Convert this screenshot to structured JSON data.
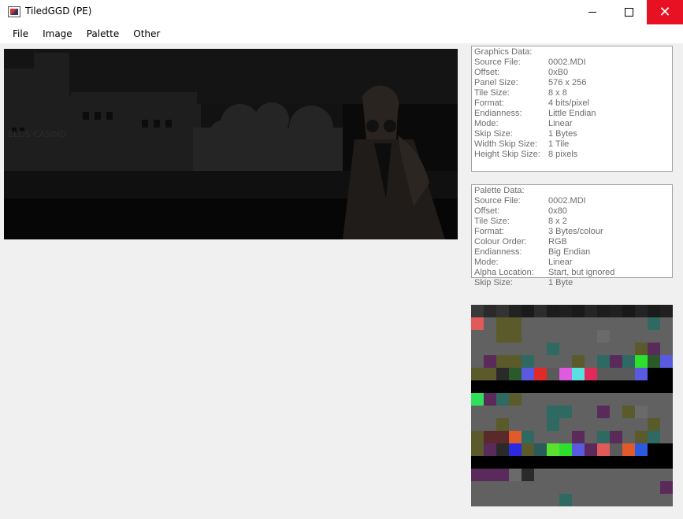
{
  "window": {
    "title": "TiledGGD (PE)"
  },
  "menu": [
    "File",
    "Image",
    "Palette",
    "Other"
  ],
  "graphics": {
    "heading": "Graphics Data:",
    "rows": [
      {
        "k": "Source File:",
        "v": "0002.MDI"
      },
      {
        "k": "Offset:",
        "v": "0xB0"
      },
      {
        "k": "Panel Size:",
        "v": "576 x 256"
      },
      {
        "k": "Tile Size:",
        "v": "8 x 8"
      },
      {
        "k": "Format:",
        "v": "4 bits/pixel"
      },
      {
        "k": "Endianness:",
        "v": "Little Endian"
      },
      {
        "k": "Mode:",
        "v": "Linear"
      },
      {
        "k": "Skip Size:",
        "v": "1 Bytes"
      },
      {
        "k": "Width Skip Size:",
        "v": "1 Tile"
      },
      {
        "k": "Height Skip Size:",
        "v": "8 pixels"
      }
    ]
  },
  "palette": {
    "heading": "Palette Data:",
    "rows": [
      {
        "k": "Source File:",
        "v": "0002.MDI"
      },
      {
        "k": "Offset:",
        "v": "0x80"
      },
      {
        "k": "Tile Size:",
        "v": "8 x 2"
      },
      {
        "k": "Format:",
        "v": "3 Bytes/colour"
      },
      {
        "k": "Colour Order:",
        "v": "RGB"
      },
      {
        "k": "Endianness:",
        "v": "Big Endian"
      },
      {
        "k": "Mode:",
        "v": "Linear"
      },
      {
        "k": "Alpha Location:",
        "v": "Start, but ignored"
      },
      {
        "k": "Skip Size:",
        "v": "1 Byte"
      }
    ]
  },
  "colors": {
    "close_button": "#e81123",
    "panel_border": "#a0a0a0",
    "label_text": "#6d6d6d",
    "palette_bg": "#616161"
  },
  "palette_swatches": [
    {
      "row": 0,
      "col": 0,
      "color": "#3a3a3a"
    },
    {
      "row": 0,
      "col": 1,
      "color": "#2a2a2a"
    },
    {
      "row": 0,
      "col": 2,
      "color": "#333333"
    },
    {
      "row": 0,
      "col": 3,
      "color": "#222222"
    },
    {
      "row": 0,
      "col": 4,
      "color": "#1a1a1a"
    },
    {
      "row": 0,
      "col": 5,
      "color": "#2c2c2c"
    },
    {
      "row": 0,
      "col": 6,
      "color": "#1c1c1c"
    },
    {
      "row": 0,
      "col": 7,
      "color": "#1f1f1f"
    },
    {
      "row": 0,
      "col": 8,
      "color": "#1a1a1a"
    },
    {
      "row": 0,
      "col": 9,
      "color": "#252525"
    },
    {
      "row": 0,
      "col": 10,
      "color": "#1d1d1d"
    },
    {
      "row": 0,
      "col": 11,
      "color": "#202020"
    },
    {
      "row": 0,
      "col": 12,
      "color": "#181818"
    },
    {
      "row": 0,
      "col": 13,
      "color": "#232323"
    },
    {
      "row": 0,
      "col": 14,
      "color": "#1b1b1b"
    },
    {
      "row": 0,
      "col": 15,
      "color": "#202020"
    },
    {
      "row": 1,
      "col": 0,
      "color": "#e05a5a"
    },
    {
      "row": 1,
      "col": 2,
      "color": "#5a5a2a"
    },
    {
      "row": 1,
      "col": 3,
      "color": "#5a5a2a"
    },
    {
      "row": 1,
      "col": 14,
      "color": "#2e6a62"
    },
    {
      "row": 2,
      "col": 2,
      "color": "#5a5a2a"
    },
    {
      "row": 2,
      "col": 3,
      "color": "#5a5a2a"
    },
    {
      "row": 2,
      "col": 10,
      "color": "#6a6a6a"
    },
    {
      "row": 3,
      "col": 6,
      "color": "#2e6a62"
    },
    {
      "row": 3,
      "col": 13,
      "color": "#5a5a2a"
    },
    {
      "row": 3,
      "col": 14,
      "color": "#5a2a5a"
    },
    {
      "row": 4,
      "col": 1,
      "color": "#5a2a5a"
    },
    {
      "row": 4,
      "col": 2,
      "color": "#5a5a2a"
    },
    {
      "row": 4,
      "col": 3,
      "color": "#5a5a2a"
    },
    {
      "row": 4,
      "col": 4,
      "color": "#2e6a62"
    },
    {
      "row": 4,
      "col": 8,
      "color": "#5a5a2a"
    },
    {
      "row": 4,
      "col": 10,
      "color": "#2e6a62"
    },
    {
      "row": 4,
      "col": 11,
      "color": "#5a2a5a"
    },
    {
      "row": 4,
      "col": 12,
      "color": "#2e6a62"
    },
    {
      "row": 4,
      "col": 13,
      "color": "#2ee02e"
    },
    {
      "row": 4,
      "col": 14,
      "color": "#2a5a2a"
    },
    {
      "row": 4,
      "col": 15,
      "color": "#5a5ae0"
    },
    {
      "row": 5,
      "col": 0,
      "color": "#5a5a2a"
    },
    {
      "row": 5,
      "col": 1,
      "color": "#5a5a2a"
    },
    {
      "row": 5,
      "col": 2,
      "color": "#2a2a2a"
    },
    {
      "row": 5,
      "col": 3,
      "color": "#2a5a2a"
    },
    {
      "row": 5,
      "col": 4,
      "color": "#5a5ae0"
    },
    {
      "row": 5,
      "col": 5,
      "color": "#e02a2a"
    },
    {
      "row": 5,
      "col": 6,
      "color": "#5a5a5a"
    },
    {
      "row": 5,
      "col": 7,
      "color": "#e05ae0"
    },
    {
      "row": 5,
      "col": 8,
      "color": "#5ae0e0"
    },
    {
      "row": 5,
      "col": 9,
      "color": "#e02a5a"
    },
    {
      "row": 5,
      "col": 10,
      "color": "#5a5a5a"
    },
    {
      "row": 5,
      "col": 11,
      "color": "#5a5a5a"
    },
    {
      "row": 5,
      "col": 12,
      "color": "#5a5a5a"
    },
    {
      "row": 5,
      "col": 13,
      "color": "#5a5ae0"
    },
    {
      "row": 5,
      "col": 14,
      "color": "#000000"
    },
    {
      "row": 5,
      "col": 15,
      "color": "#000000"
    },
    {
      "row": 6,
      "col": 0,
      "color": "#000000"
    },
    {
      "row": 6,
      "col": 1,
      "color": "#000000"
    },
    {
      "row": 6,
      "col": 2,
      "color": "#000000"
    },
    {
      "row": 6,
      "col": 3,
      "color": "#000000"
    },
    {
      "row": 6,
      "col": 4,
      "color": "#000000"
    },
    {
      "row": 6,
      "col": 5,
      "color": "#000000"
    },
    {
      "row": 6,
      "col": 6,
      "color": "#000000"
    },
    {
      "row": 6,
      "col": 7,
      "color": "#000000"
    },
    {
      "row": 6,
      "col": 8,
      "color": "#000000"
    },
    {
      "row": 6,
      "col": 9,
      "color": "#000000"
    },
    {
      "row": 6,
      "col": 10,
      "color": "#000000"
    },
    {
      "row": 6,
      "col": 11,
      "color": "#000000"
    },
    {
      "row": 6,
      "col": 12,
      "color": "#000000"
    },
    {
      "row": 6,
      "col": 13,
      "color": "#000000"
    },
    {
      "row": 6,
      "col": 14,
      "color": "#000000"
    },
    {
      "row": 6,
      "col": 15,
      "color": "#000000"
    },
    {
      "row": 7,
      "col": 0,
      "color": "#2ee05a"
    },
    {
      "row": 7,
      "col": 1,
      "color": "#5a2a5a"
    },
    {
      "row": 7,
      "col": 2,
      "color": "#2e6a62"
    },
    {
      "row": 7,
      "col": 3,
      "color": "#5a5a2a"
    },
    {
      "row": 8,
      "col": 6,
      "color": "#2e6a62"
    },
    {
      "row": 8,
      "col": 7,
      "color": "#2e6a62"
    },
    {
      "row": 8,
      "col": 10,
      "color": "#5a2a5a"
    },
    {
      "row": 8,
      "col": 12,
      "color": "#5a5a2a"
    },
    {
      "row": 8,
      "col": 13,
      "color": "#6a6a6a"
    },
    {
      "row": 9,
      "col": 2,
      "color": "#5a5a2a"
    },
    {
      "row": 9,
      "col": 6,
      "color": "#2e6a62"
    },
    {
      "row": 9,
      "col": 14,
      "color": "#5a5a2a"
    },
    {
      "row": 10,
      "col": 0,
      "color": "#5a5a2a"
    },
    {
      "row": 10,
      "col": 1,
      "color": "#5a2a2a"
    },
    {
      "row": 10,
      "col": 2,
      "color": "#5a2a2a"
    },
    {
      "row": 10,
      "col": 3,
      "color": "#e05a2a"
    },
    {
      "row": 10,
      "col": 4,
      "color": "#2e6a62"
    },
    {
      "row": 10,
      "col": 8,
      "color": "#5a2a5a"
    },
    {
      "row": 10,
      "col": 10,
      "color": "#2e6a62"
    },
    {
      "row": 10,
      "col": 11,
      "color": "#5a2a5a"
    },
    {
      "row": 10,
      "col": 13,
      "color": "#5a5a2a"
    },
    {
      "row": 10,
      "col": 14,
      "color": "#2e6a62"
    },
    {
      "row": 11,
      "col": 0,
      "color": "#5a5a2a"
    },
    {
      "row": 11,
      "col": 1,
      "color": "#5a2a5a"
    },
    {
      "row": 11,
      "col": 2,
      "color": "#2a2a2a"
    },
    {
      "row": 11,
      "col": 3,
      "color": "#2a2ae0"
    },
    {
      "row": 11,
      "col": 4,
      "color": "#5a5a2a"
    },
    {
      "row": 11,
      "col": 5,
      "color": "#2a5a5a"
    },
    {
      "row": 11,
      "col": 6,
      "color": "#5ae02e"
    },
    {
      "row": 11,
      "col": 7,
      "color": "#2ee02e"
    },
    {
      "row": 11,
      "col": 8,
      "color": "#5a5ae0"
    },
    {
      "row": 11,
      "col": 9,
      "color": "#5a2a5a"
    },
    {
      "row": 11,
      "col": 10,
      "color": "#e05a5a"
    },
    {
      "row": 11,
      "col": 11,
      "color": "#5a5a5a"
    },
    {
      "row": 11,
      "col": 12,
      "color": "#e05a2a"
    },
    {
      "row": 11,
      "col": 13,
      "color": "#2a5ae0"
    },
    {
      "row": 11,
      "col": 14,
      "color": "#000000"
    },
    {
      "row": 11,
      "col": 15,
      "color": "#000000"
    },
    {
      "row": 12,
      "col": 0,
      "color": "#000000"
    },
    {
      "row": 12,
      "col": 1,
      "color": "#000000"
    },
    {
      "row": 12,
      "col": 2,
      "color": "#000000"
    },
    {
      "row": 12,
      "col": 3,
      "color": "#000000"
    },
    {
      "row": 12,
      "col": 4,
      "color": "#000000"
    },
    {
      "row": 12,
      "col": 5,
      "color": "#000000"
    },
    {
      "row": 12,
      "col": 6,
      "color": "#000000"
    },
    {
      "row": 12,
      "col": 7,
      "color": "#000000"
    },
    {
      "row": 12,
      "col": 8,
      "color": "#000000"
    },
    {
      "row": 12,
      "col": 9,
      "color": "#000000"
    },
    {
      "row": 12,
      "col": 10,
      "color": "#000000"
    },
    {
      "row": 12,
      "col": 11,
      "color": "#000000"
    },
    {
      "row": 12,
      "col": 12,
      "color": "#000000"
    },
    {
      "row": 12,
      "col": 13,
      "color": "#000000"
    },
    {
      "row": 12,
      "col": 14,
      "color": "#000000"
    },
    {
      "row": 12,
      "col": 15,
      "color": "#000000"
    },
    {
      "row": 13,
      "col": 0,
      "color": "#5a2a5a"
    },
    {
      "row": 13,
      "col": 1,
      "color": "#5a2a5a"
    },
    {
      "row": 13,
      "col": 2,
      "color": "#5a2a5a"
    },
    {
      "row": 13,
      "col": 3,
      "color": "#6a6a6a"
    },
    {
      "row": 13,
      "col": 4,
      "color": "#2a2a2a"
    },
    {
      "row": 14,
      "col": 15,
      "color": "#5a2a5a"
    },
    {
      "row": 15,
      "col": 7,
      "color": "#2e6a62"
    }
  ]
}
